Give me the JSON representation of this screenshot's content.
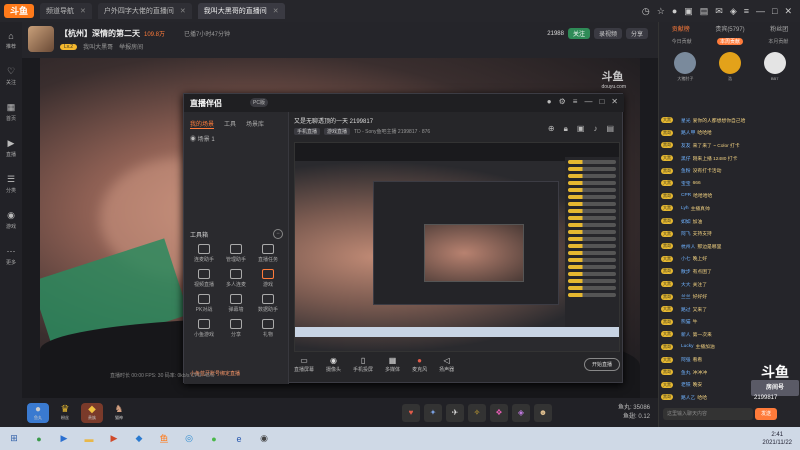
{
  "titlebar": {
    "logo": "斗鱼",
    "tabs": [
      {
        "label": "频道导航",
        "active": false
      },
      {
        "label": "户外四字大佬的直播间",
        "active": false
      },
      {
        "label": "我叫大黑哥的直播间",
        "active": true
      }
    ],
    "icons": [
      "time-icon",
      "star-icon",
      "history-icon",
      "bag-icon",
      "chat-icon",
      "message-icon",
      "skin-icon",
      "menu-icon",
      "minimize-icon",
      "maximize-icon",
      "close-icon"
    ]
  },
  "leftrail": {
    "items": [
      "推荐",
      "关注",
      "首页",
      "直播",
      "分类",
      "游戏",
      "更多"
    ]
  },
  "header": {
    "title": "【杭州】深情的第二天",
    "hot": "109.8万",
    "meta": "已播7小时47分钟",
    "report": "举报房间",
    "level": "Lv.2",
    "tag": "我叫大黑哥",
    "id": "21988",
    "follow_label": "关注",
    "share_label": "分享",
    "record_label": "录视频"
  },
  "video": {
    "watermark": "斗鱼",
    "watermark_sub": "douyu.com"
  },
  "tool": {
    "logo": "直播伴侣",
    "version": "PC版",
    "scene_tabs": [
      "我的场景",
      "工具",
      "场景库"
    ],
    "scene_name": "场景 1",
    "toolbox_title": "工具箱",
    "tools": [
      "连麦助手",
      "管理助手",
      "直播任务",
      "视频直播",
      "多人连麦",
      "游戏",
      "PK对战",
      "弹幕墙",
      "数据助手",
      "小鱼游戏",
      "分享",
      "礼物"
    ],
    "bottom_note": "小鱼蓝牙账号绑定直播",
    "main_title": "又是无聊透顶的一天 2199817",
    "chips": [
      "手机直播",
      "游戏直播"
    ],
    "room_info": "TD - Sony鱼吧主播 2199817 · 876",
    "footer": [
      {
        "label": "直播屏幕",
        "icon": "screen-icon"
      },
      {
        "label": "摄像头",
        "icon": "camera-icon"
      },
      {
        "label": "手机投屏",
        "icon": "phone-icon"
      },
      {
        "label": "多媒体",
        "icon": "media-icon"
      },
      {
        "label": "麦克风",
        "icon": "mic-icon"
      },
      {
        "label": "扬声器",
        "icon": "speaker-icon"
      }
    ],
    "golive_label": "开始直播",
    "status": "直播时长 00:00   FPS: 30   码率: 0kb/s   CPU: 45%"
  },
  "giftbar": {
    "left": [
      "鱼丸",
      "粉丝",
      "贵族",
      "猫神"
    ],
    "mid_icons": [
      "heart-icon",
      "sword-icon",
      "plane-icon",
      "wand-icon",
      "gift-icon",
      "dress-icon",
      "cat-icon"
    ],
    "fish_label": "鱼丸: 35086",
    "fish_label2": "鱼翅: 0.12"
  },
  "chat": {
    "tabs": [
      "贡献榜",
      "贵宾(5797)",
      "粉丝团"
    ],
    "subtabs": [
      "今日贡献",
      "本周贡献",
      "本月贡献"
    ],
    "rank": [
      {
        "name": "大猪肘子",
        "color": "#7a8a9c"
      },
      {
        "name": "浩",
        "color": "#e3a21a"
      },
      {
        "name": "BB7",
        "color": "#e4e4e4"
      }
    ],
    "messages": [
      {
        "badge": "大黑",
        "nick": "星光",
        "text": "爱你的人都想想你自己哈"
      },
      {
        "badge": "黑哥",
        "nick": "路人甲",
        "text": "哈哈哈"
      },
      {
        "badge": "黑哥",
        "nick": "友友",
        "text": "来了来了 ~ Color 打卡"
      },
      {
        "badge": "大黑",
        "nick": "黑仔",
        "text": "刚来上播 12480 打卡"
      },
      {
        "badge": "黑哥",
        "nick": "鱼粉",
        "text": "没有打卡活动"
      },
      {
        "badge": "大黑",
        "nick": "宝宝",
        "text": "666"
      },
      {
        "badge": "黑哥",
        "nick": "CPR",
        "text": "哈哈哈哈"
      },
      {
        "badge": "大黑",
        "nick": "Lyh",
        "text": "主播真帅"
      },
      {
        "badge": "黑哥",
        "nick": "如如",
        "text": "加油"
      },
      {
        "badge": "大黑",
        "nick": "阿飞",
        "text": "支持支持"
      },
      {
        "badge": "黑哥",
        "nick": "杭州人",
        "text": "那边是哪里"
      },
      {
        "badge": "大黑",
        "nick": "小七",
        "text": "晚上好"
      },
      {
        "badge": "黑哥",
        "nick": "散步",
        "text": "有点困了"
      },
      {
        "badge": "大黑",
        "nick": "大大",
        "text": "关注了"
      },
      {
        "badge": "黑哥",
        "nick": "兰兰",
        "text": "好好好"
      },
      {
        "badge": "大黑",
        "nick": "路过",
        "text": "又来了"
      },
      {
        "badge": "黑哥",
        "nick": "熊猫",
        "text": "牛"
      },
      {
        "badge": "大黑",
        "nick": "新人",
        "text": "第一次来"
      },
      {
        "badge": "黑哥",
        "nick": "Lucky",
        "text": "主播加油"
      },
      {
        "badge": "大黑",
        "nick": "阿强",
        "text": "看看"
      },
      {
        "badge": "黑哥",
        "nick": "鱼丸",
        "text": "冲冲冲"
      },
      {
        "badge": "大黑",
        "nick": "老铁",
        "text": "晚安"
      },
      {
        "badge": "黑哥",
        "nick": "路人乙",
        "text": "哈哈"
      }
    ],
    "input_placeholder": "这里输入聊天内容",
    "send_label": "发送",
    "brand": "斗鱼",
    "brand_sub": "房间号",
    "brand_num": "2199817"
  },
  "taskbar": {
    "apps": [
      {
        "icon": "start-icon",
        "glyph": "⊞",
        "color": "#2f5fa8"
      },
      {
        "icon": "chrome-icon",
        "glyph": "●",
        "color": "#3a9a4a"
      },
      {
        "icon": "media-player-icon",
        "glyph": "▶",
        "color": "#2a6fd0"
      },
      {
        "icon": "folder-icon",
        "glyph": "▬",
        "color": "#e8b84a"
      },
      {
        "icon": "play-icon",
        "glyph": "▶",
        "color": "#d04a2a"
      },
      {
        "icon": "store-icon",
        "glyph": "◆",
        "color": "#2a7ad0"
      },
      {
        "icon": "douyu-icon",
        "glyph": "鱼",
        "color": "#ff7a1a"
      },
      {
        "icon": "qq-icon",
        "glyph": "◎",
        "color": "#2a8ad0"
      },
      {
        "icon": "wechat-icon",
        "glyph": "●",
        "color": "#4ab84a"
      },
      {
        "icon": "browser-icon",
        "glyph": "e",
        "color": "#2a5ab0"
      },
      {
        "icon": "obs-icon",
        "glyph": "◉",
        "color": "#444"
      }
    ],
    "time": "2:41",
    "date": "2021/11/22"
  }
}
